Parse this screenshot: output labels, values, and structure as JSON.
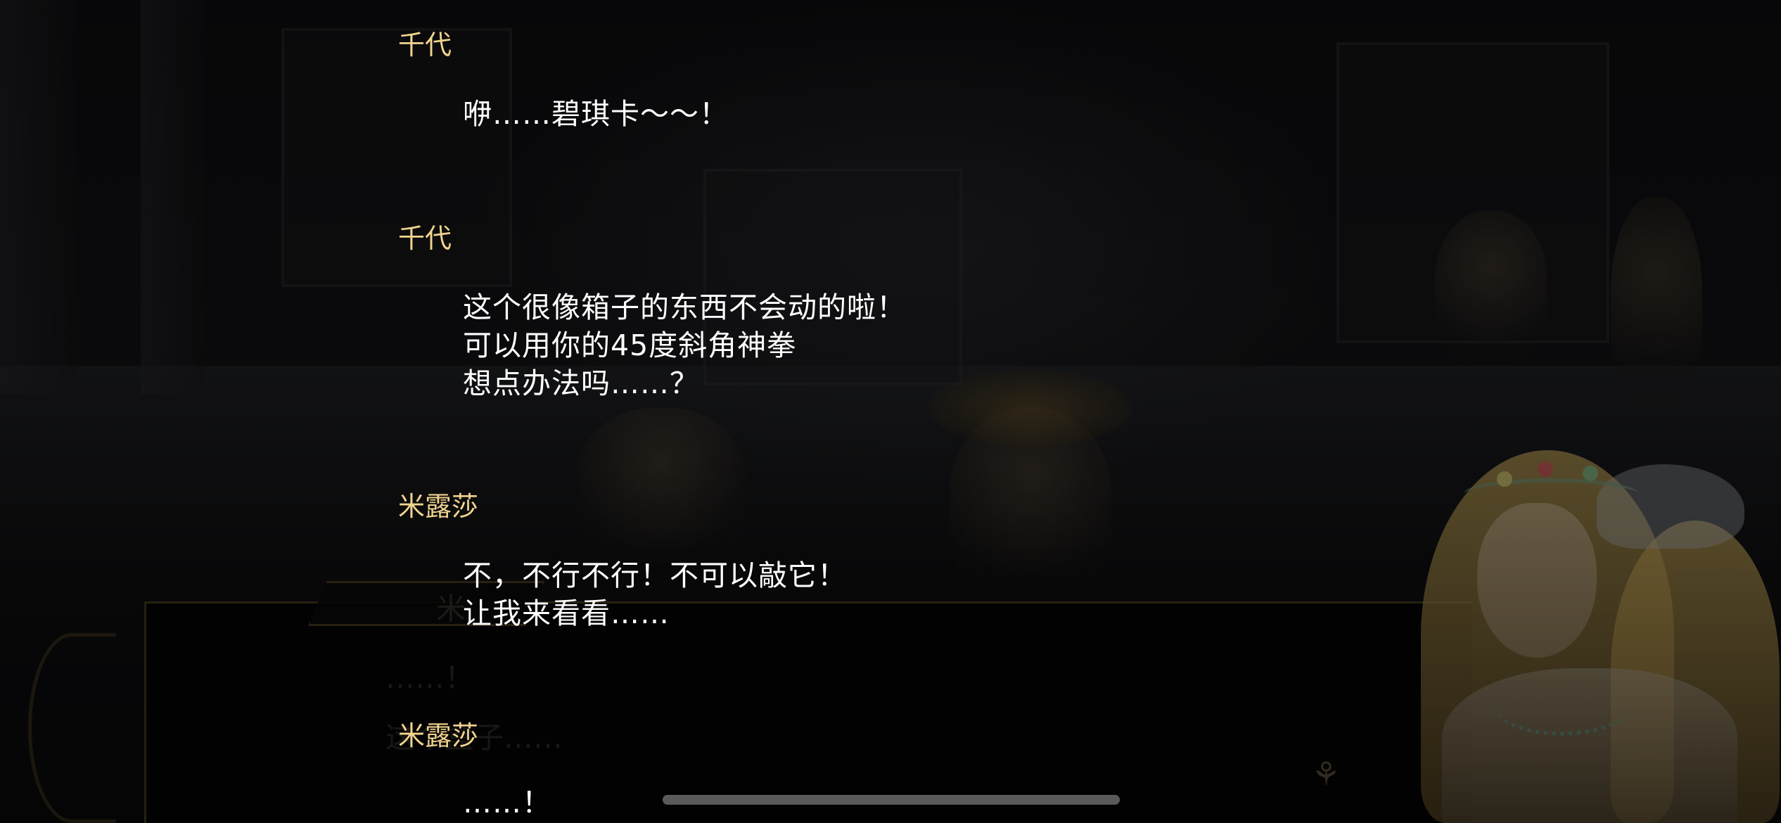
{
  "log": [
    {
      "speaker": "千代",
      "lines": [
        "咿……碧琪卡～～！"
      ]
    },
    {
      "speaker": "千代",
      "lines": [
        "这个很像箱子的东西不会动的啦！",
        "可以用你的45度斜角神拳",
        "想点办法吗……？"
      ]
    },
    {
      "speaker": "米露莎",
      "lines": [
        "不，不行不行！不可以敲它！",
        "让我来看看……"
      ]
    },
    {
      "speaker": "米露莎",
      "lines": [
        "……！"
      ]
    }
  ],
  "background_dialogue": {
    "name": "米",
    "line1": "……！",
    "line2": "这个盒子……"
  },
  "icons": {
    "next": "winged-emblem-icon"
  },
  "colors": {
    "speaker": "#f0d38e",
    "text": "#ffffff"
  }
}
